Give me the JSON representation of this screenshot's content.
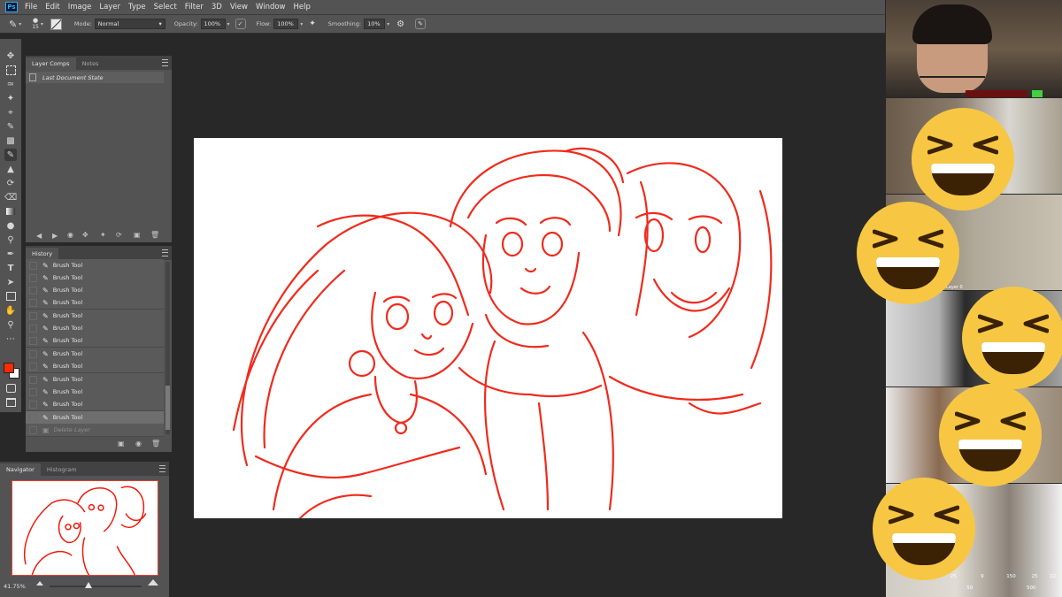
{
  "app": {
    "logo_text": "Ps",
    "menu": [
      "File",
      "Edit",
      "Image",
      "Layer",
      "Type",
      "Select",
      "Filter",
      "3D",
      "View",
      "Window",
      "Help"
    ]
  },
  "options_bar": {
    "brush_size": "15",
    "mode_label": "Mode:",
    "mode_value": "Normal",
    "opacity_label": "Opacity:",
    "opacity_value": "100%",
    "flow_label": "Flow:",
    "flow_value": "100%",
    "smoothing_label": "Smoothing:",
    "smoothing_value": "10%"
  },
  "layer_comps_panel": {
    "tabs": [
      "Layer Comps",
      "Notes"
    ],
    "item": "Last Document State"
  },
  "history_panel": {
    "tab": "History",
    "items": [
      "Brush Tool",
      "Brush Tool",
      "Brush Tool",
      "Brush Tool",
      "Brush Tool",
      "Brush Tool",
      "Brush Tool",
      "Brush Tool",
      "Brush Tool",
      "Brush Tool",
      "Brush Tool",
      "Brush Tool",
      "Brush Tool"
    ],
    "ghost_item": "Delete Layer"
  },
  "navigator_panel": {
    "tabs": [
      "Navigator",
      "Histogram"
    ],
    "zoom": "41.75%"
  },
  "participants": {
    "layer_label": "Layer 0",
    "bottom_numbers": [
      "25",
      "9",
      "150",
      "25",
      "22",
      "50",
      "500"
    ]
  },
  "colors": {
    "foreground": "#ff2a00",
    "background": "#ffffff",
    "sketch_stroke": "#ee1a0a",
    "emoji_face": "#f7c744"
  }
}
